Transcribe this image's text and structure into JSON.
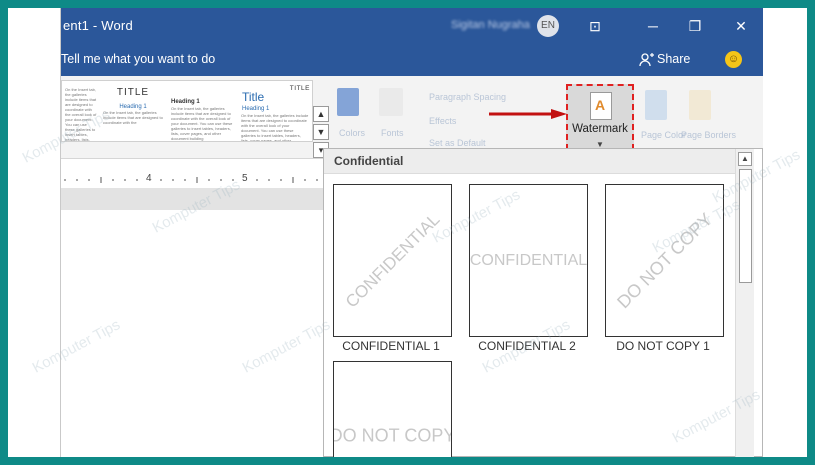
{
  "app": {
    "title": "ent1  -  Word",
    "user_name": "Sigitan Nugraha",
    "language": "EN",
    "window_controls": {
      "restore_ribbon": "⊡",
      "minimize": "─",
      "maximize": "❐",
      "close": "✕"
    }
  },
  "menubar": {
    "tell_me": "Tell me what you want to do",
    "share": "Share",
    "share_icon": "person-add-icon",
    "smiley_icon": "smiley-icon"
  },
  "ribbon": {
    "styles": [
      {
        "heading": "",
        "body": "On the Insert tab, the galleries include items that are designed to coordinate with the overall look of your document. You can use these galleries to insert tables, headers, lists, cover pages."
      },
      {
        "heading": "TITLE",
        "sub": "Heading 1",
        "body": "On the Insert tab, the galleries include items that are designed to coordinate with the"
      },
      {
        "heading": "Heading 1",
        "body": "On the Insert tab, the galleries include items that are designed to coordinate with the overall look of your document. You can use these galleries to insert tables, headers, lists, cover pages, and other document building"
      },
      {
        "heading": "Title",
        "sub": "Heading 1",
        "body": "On the Insert tab, the galleries include items that are designed to coordinate with the overall look of your document. You can use these galleries to insert tables, headers, lists, cover pages, and other document building"
      },
      {
        "heading": "TITLE",
        "body": ""
      }
    ],
    "paragraph_spacing": "Paragraph Spacing",
    "effects": "Effects",
    "set_as_default": "Set as Default",
    "colors": "Colors",
    "fonts": "Fonts",
    "watermark": "Watermark",
    "page_color": "Page Color",
    "page_borders": "Page Borders"
  },
  "ruler": {
    "marks": [
      "4",
      "5"
    ]
  },
  "gallery": {
    "section_title": "Confidential",
    "items": [
      {
        "caption": "CONFIDENTIAL 1",
        "text": "CONFIDENTIAL",
        "style": "diagonal"
      },
      {
        "caption": "CONFIDENTIAL 2",
        "text": "CONFIDENTIAL",
        "style": "horizontal"
      },
      {
        "caption": "DO NOT COPY 1",
        "text": "DO NOT COPY",
        "style": "diagonal"
      },
      {
        "caption": "",
        "text": "DO NOT COPY",
        "style": "horizontal"
      }
    ]
  },
  "site_watermark": "Komputer Tips",
  "colors": {
    "title_bar": "#2b579a",
    "frame": "#0e8a87",
    "highlight": "#e02020"
  }
}
